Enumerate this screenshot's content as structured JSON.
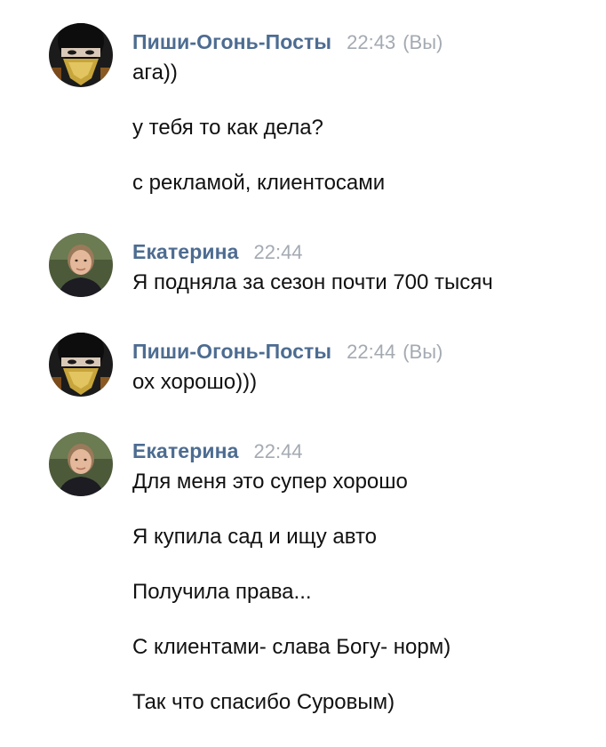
{
  "messages": [
    {
      "author": "Пиши-Огонь-Посты",
      "time": "22:43",
      "you_label": "(Вы)",
      "avatar": "masked-ninja-avatar",
      "lines": [
        "ага))",
        "у тебя то как дела?",
        "с рекламой, клиентосами"
      ]
    },
    {
      "author": "Екатерина",
      "time": "22:44",
      "avatar": "woman-portrait-avatar",
      "lines": [
        "Я подняла за сезон почти 700 тысяч"
      ]
    },
    {
      "author": "Пиши-Огонь-Посты",
      "time": "22:44",
      "you_label": "(Вы)",
      "avatar": "masked-ninja-avatar",
      "lines": [
        "ох хорошо)))"
      ]
    },
    {
      "author": "Екатерина",
      "time": "22:44",
      "avatar": "woman-portrait-avatar",
      "lines": [
        "Для меня это супер хорошо",
        "Я купила сад и ищу авто",
        "Получила права...",
        "С клиентами- слава Богу- норм)",
        "Так что спасибо Суровым)"
      ]
    }
  ],
  "colors": {
    "author": "#4d6c91",
    "meta": "#a4aab2",
    "text": "#111111",
    "background": "#ffffff"
  }
}
